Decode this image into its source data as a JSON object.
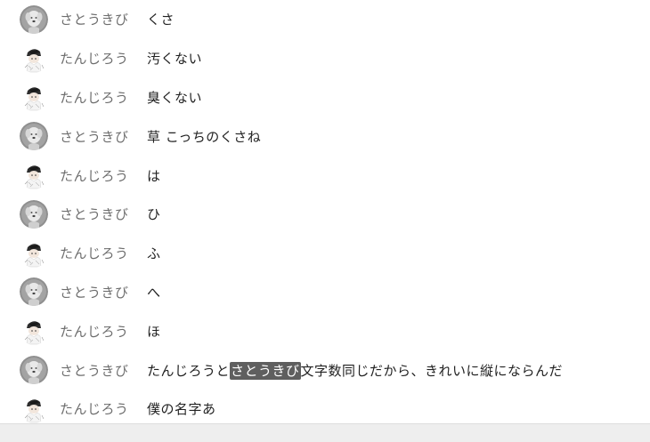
{
  "speakers": {
    "a": "さとうきび",
    "b": "たんじろう"
  },
  "messages": [
    {
      "speaker": "a",
      "text": "くさ"
    },
    {
      "speaker": "b",
      "text": "汚くない"
    },
    {
      "speaker": "b",
      "text": "臭くない"
    },
    {
      "speaker": "a",
      "text": "草 こっちのくさね"
    },
    {
      "speaker": "b",
      "text": "は"
    },
    {
      "speaker": "a",
      "text": "ひ"
    },
    {
      "speaker": "b",
      "text": "ふ"
    },
    {
      "speaker": "a",
      "text": "へ"
    },
    {
      "speaker": "b",
      "text": "ほ"
    },
    {
      "speaker": "a",
      "text_before": "たんじろうと",
      "text_highlight": "さとうきび",
      "text_after": "文字数同じだから、きれいに縦にならんだ"
    },
    {
      "speaker": "b",
      "text": "僕の名字あ"
    }
  ],
  "colors": {
    "speaker_name": "#6e6e6e",
    "message_text": "#222222",
    "highlight_bg": "#5f5f5f",
    "highlight_text": "#ffffff"
  },
  "icons": {
    "a": "dog-avatar-icon",
    "b": "anime-character-avatar-icon"
  }
}
